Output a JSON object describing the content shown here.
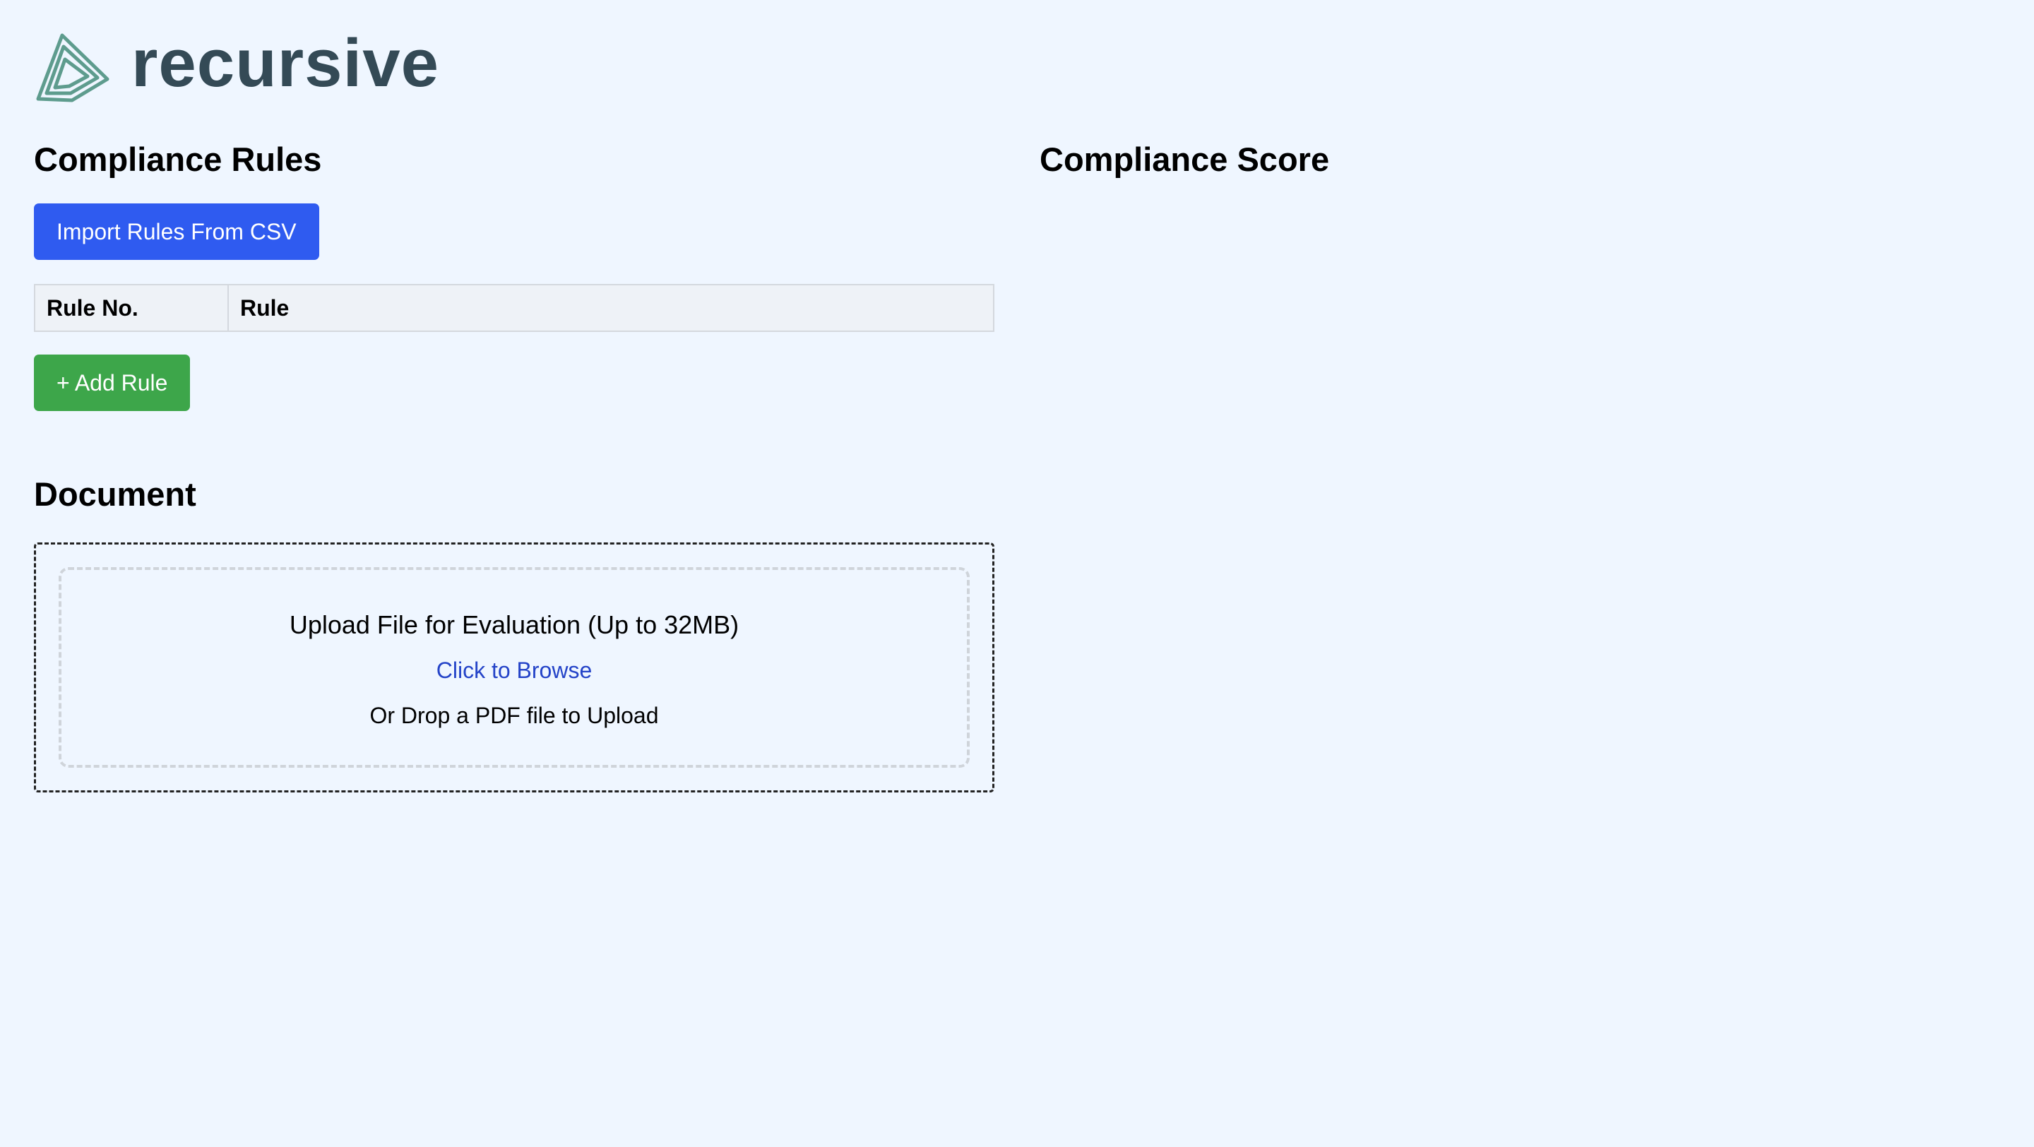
{
  "brand": {
    "name": "recursive",
    "color": "#344a56",
    "icon": "recursive-logo-icon",
    "icon_color": "#5e9c8e"
  },
  "rules": {
    "title": "Compliance Rules",
    "import_button": "Import Rules From CSV",
    "table_headers": [
      "Rule No.",
      "Rule"
    ],
    "rows": [],
    "add_button": "+ Add Rule"
  },
  "score": {
    "title": "Compliance Score"
  },
  "document": {
    "title": "Document",
    "upload_title": "Upload File for Evaluation (Up to 32MB)",
    "browse_link": "Click to Browse",
    "drop_hint": "Or Drop a PDF file to Upload"
  },
  "colors": {
    "background": "#eff6ff",
    "primary_button": "#2f5bf0",
    "success_button": "#3da64a",
    "link": "#2443c8"
  }
}
